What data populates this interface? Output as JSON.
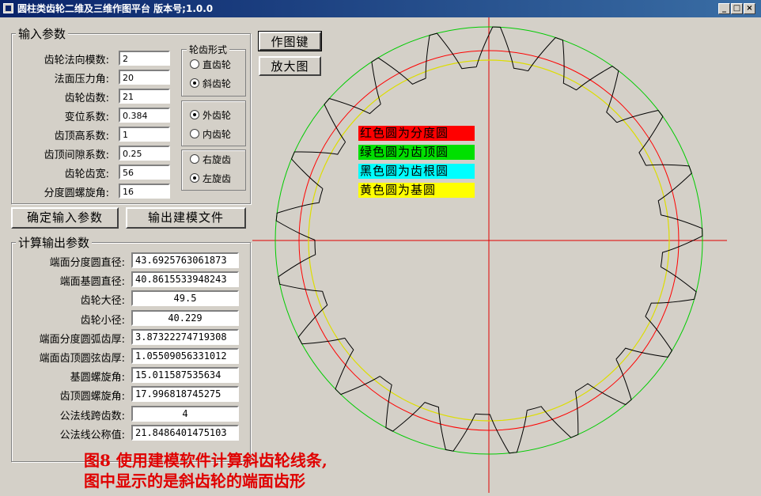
{
  "window": {
    "title": "圆柱类齿轮二维及三维作图平台 版本号;1.0.0",
    "minimize_icon": "minimize-icon",
    "maximize_icon": "maximize-icon",
    "close_icon": "close-icon"
  },
  "input_group": {
    "title": "输入参数",
    "fields": [
      {
        "label": "齿轮法向模数:",
        "value": "2"
      },
      {
        "label": "法面压力角:",
        "value": "20"
      },
      {
        "label": "齿轮齿数:",
        "value": "21"
      },
      {
        "label": "变位系数:",
        "value": "0.384"
      },
      {
        "label": "齿顶高系数:",
        "value": "1"
      },
      {
        "label": "齿顶间隙系数:",
        "value": "0.25"
      },
      {
        "label": "齿轮齿宽:",
        "value": "56"
      },
      {
        "label": "分度圆螺旋角:",
        "value": "16"
      }
    ],
    "tooth_form": {
      "title": "轮齿形式",
      "options": [
        {
          "label": "直齿轮",
          "selected": false
        },
        {
          "label": "斜齿轮",
          "selected": true
        }
      ]
    },
    "gear_type": {
      "options": [
        {
          "label": "外齿轮",
          "selected": true
        },
        {
          "label": "内齿轮",
          "selected": false
        }
      ]
    },
    "helix_dir": {
      "options": [
        {
          "label": "右旋齿",
          "selected": false
        },
        {
          "label": "左旋齿",
          "selected": true
        }
      ]
    }
  },
  "buttons": {
    "confirm": "确定输入参数",
    "export": "输出建模文件",
    "draw": "作图键",
    "zoom": "放大图"
  },
  "output_group": {
    "title": "计算输出参数",
    "fields": [
      {
        "label": "端面分度圆直径:",
        "value": "43.6925763061873"
      },
      {
        "label": "端面基圆直径:",
        "value": "40.8615533948243"
      },
      {
        "label": "齿轮大径:",
        "value": "49.5"
      },
      {
        "label": "齿轮小径:",
        "value": "40.229"
      },
      {
        "label": "端面分度圆弧齿厚:",
        "value": "3.87322274719308"
      },
      {
        "label": "端面齿顶圆弦齿厚:",
        "value": "1.05509056331012"
      },
      {
        "label": "基圆螺旋角:",
        "value": "15.011587535634"
      },
      {
        "label": "齿顶圆螺旋角:",
        "value": "17.996818745275"
      },
      {
        "label": "公法线跨齿数:",
        "value": "4"
      },
      {
        "label": "公法线公称值:",
        "value": "21.8486401475103"
      }
    ]
  },
  "legend": [
    {
      "text": "红色圆为分度圆",
      "color": "#ff0000"
    },
    {
      "text": "绿色圆为齿顶圆",
      "color": "#00e000"
    },
    {
      "text": "黑色圆为齿根圆",
      "color": "#00ffff"
    },
    {
      "text": "黄色圆为基圆",
      "color": "#ffff00"
    }
  ],
  "gear_drawing": {
    "teeth": 21,
    "circle_colors": {
      "pitch": "#ff0000",
      "addendum": "#00cc00",
      "root": "#000000",
      "base": "#dddd00",
      "axes": "#e00000"
    }
  },
  "caption": {
    "line1": "图8 使用建模软件计算斜齿轮线条,",
    "line2": "图中显示的是斜齿轮的端面齿形"
  }
}
